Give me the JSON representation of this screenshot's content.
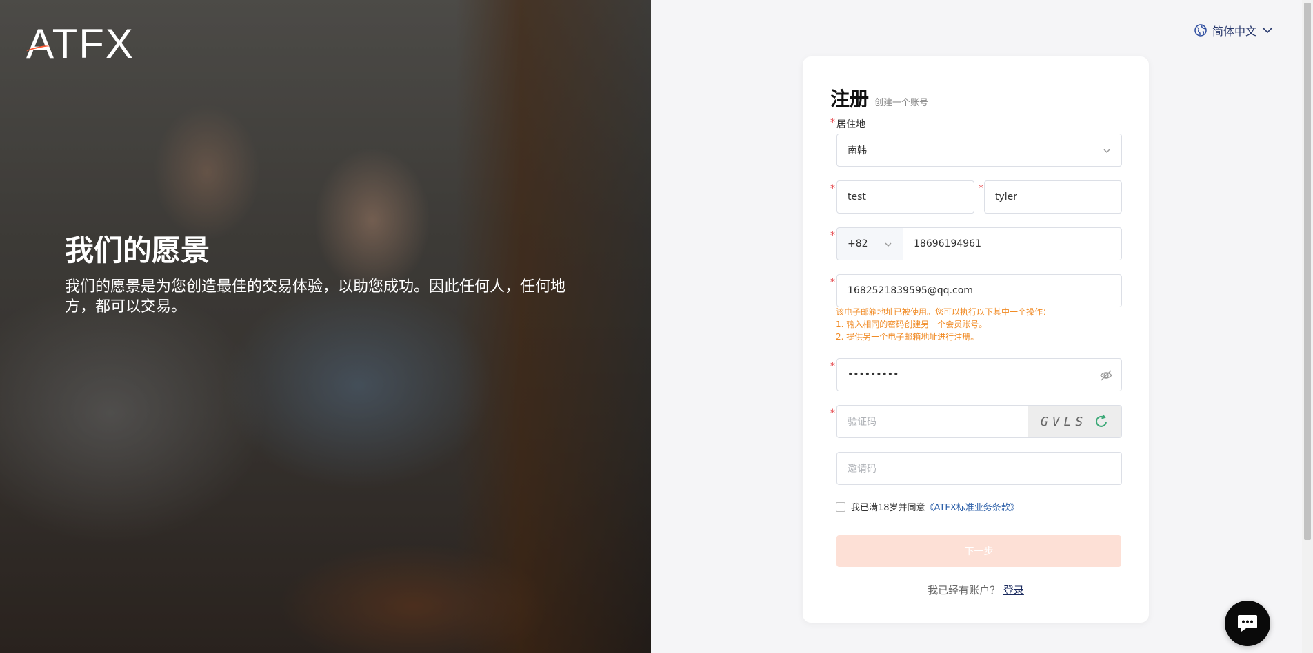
{
  "hero": {
    "logo": "ATFX",
    "heading": "我们的愿景",
    "description": "我们的愿景是为您创造最佳的交易体验，以助您成功。因此任何人，任何地方，都可以交易。"
  },
  "language": {
    "label": "简体中文",
    "icon": "globe-icon"
  },
  "form": {
    "title": "注册",
    "subtitle": "创建一个账号",
    "residence_label": "居住地",
    "residence_value": "南韩",
    "first_name": "test",
    "last_name": "tyler",
    "phone_code": "+82",
    "phone": "18696194961",
    "email": "1682521839595@qq.com",
    "email_warning": [
      "该电子邮箱地址已被使用。您可以执行以下其中一个操作：",
      "1. 输入相同的密码创建另一个会员账号。",
      "2. 提供另一个电子邮箱地址进行注册。"
    ],
    "password_mask": "•••••••••",
    "captcha_placeholder": "验证码",
    "captcha_text": "GVLS",
    "invite_placeholder": "邀请码",
    "agree_text": "我已满18岁并同意",
    "terms_link": "《ATFX标准业务条款》",
    "next_button": "下一步",
    "have_account": "我已经有账户？",
    "login_link": "登录"
  },
  "colors": {
    "accent": "#ff5a32",
    "warning": "#f08a24",
    "button_disabled": "#fde0d6",
    "link": "#2c5fa8"
  }
}
